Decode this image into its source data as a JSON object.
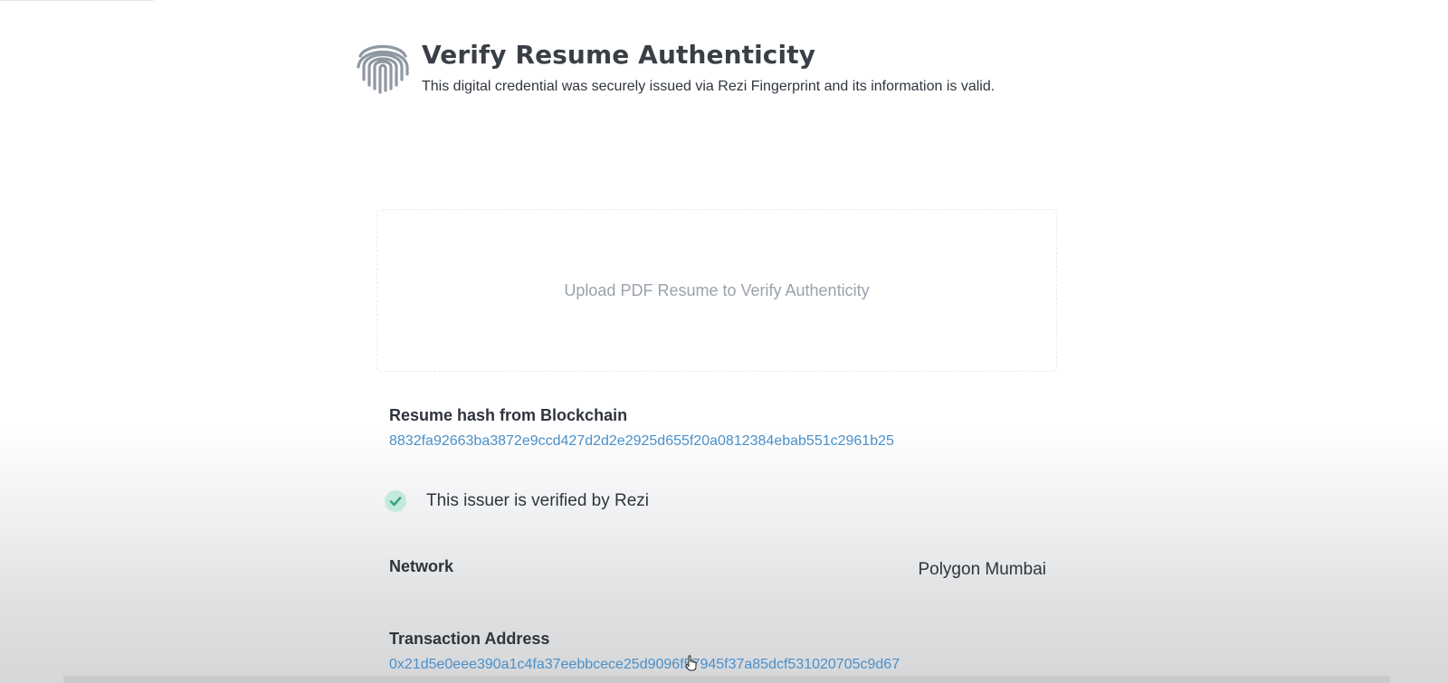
{
  "header": {
    "icon": "fingerprint-icon",
    "title": "Verify Resume Authenticity",
    "subtitle": "This digital credential was securely issued via Rezi Fingerprint and its information is valid."
  },
  "upload": {
    "label": "Upload PDF Resume to Verify Authenticity"
  },
  "resume_hash": {
    "label": "Resume hash from Blockchain",
    "value": "8832fa92663ba3872e9ccd427d2d2e2925d655f20a0812384ebab551c2961b25"
  },
  "issuer": {
    "icon": "check-circle-icon",
    "text": "This issuer is verified by Rezi"
  },
  "network": {
    "label": "Network",
    "value": "Polygon Mumbai"
  },
  "transaction": {
    "label": "Transaction Address",
    "value": "0x21d5e0eee390a1c4fa37eebbcece25d9096f57945f37a85dcf531020705c9d67"
  },
  "colors": {
    "link": "#4a90c9",
    "check_bg": "#c4eadc",
    "check_mark": "#3aa387",
    "icon_gray": "#8f97a3"
  }
}
